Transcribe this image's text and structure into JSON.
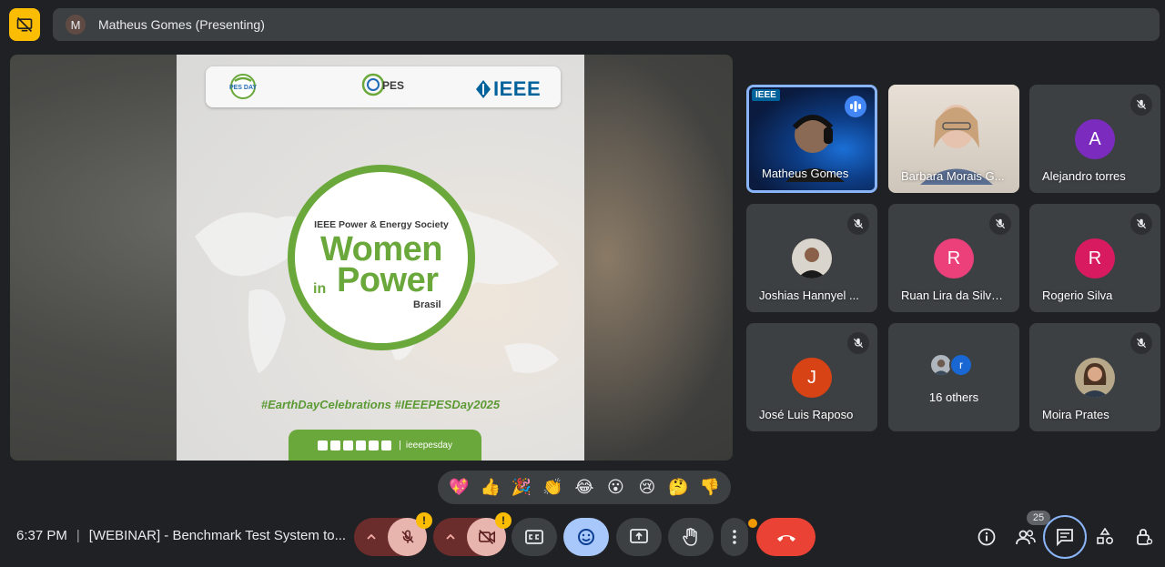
{
  "presenting": {
    "avatar_initial": "M",
    "label": "Matheus Gomes (Presenting)"
  },
  "slide": {
    "logos": {
      "pesday_badge": "PES DAY",
      "pes": "PES",
      "ieee": "IEEE"
    },
    "society": "IEEE Power & Energy Society",
    "women": "Women",
    "in": "in",
    "power": "Power",
    "brasil": "Brasil",
    "hashtags": "#EarthDayCelebrations  #IEEEPESDay2025",
    "social_handle": "ieeepesday",
    "social_sep": "|"
  },
  "participants": [
    {
      "name": "Matheus Gomes",
      "state": "speaking",
      "overlay_text": "IEEE"
    },
    {
      "name": "Barbara Morais G...",
      "state": "video"
    },
    {
      "name": "Alejandro torres",
      "initial": "A",
      "color": "#7b2cbf",
      "muted": true
    },
    {
      "name": "Joshias Hannyel ...",
      "muted": true,
      "photo": true
    },
    {
      "name": "Ruan Lira da Silva ...",
      "initial": "R",
      "color": "#ec407a",
      "muted": true
    },
    {
      "name": "Rogerio Silva",
      "initial": "R",
      "color": "#d81b60",
      "muted": true
    },
    {
      "name": "José Luis Raposo",
      "initial": "J",
      "color": "#d84315",
      "muted": true
    },
    {
      "name": "16 others",
      "mini_initial": "r",
      "mini_color": "#1967d2"
    },
    {
      "name": "Moira Prates",
      "muted": true,
      "photo": true
    }
  ],
  "reactions": [
    "💖",
    "👍",
    "🎉",
    "👏",
    "😂",
    "😮",
    "😢",
    "🤔",
    "👎"
  ],
  "bottom": {
    "time": "6:37 PM",
    "separator": "|",
    "meeting_title": "[WEBINAR] - Benchmark Test System to...",
    "warn_mark": "!",
    "participant_count": "25"
  },
  "colors": {
    "accent_blue": "#8ab4f8",
    "end_call_red": "#ea4335",
    "warning_yellow": "#fbbc04",
    "brand_green": "#6ba83b"
  }
}
